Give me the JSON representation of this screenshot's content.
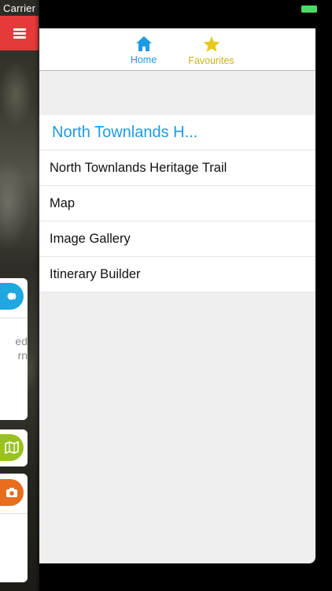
{
  "status_bar": {
    "carrier": "Carrier"
  },
  "background_app": {
    "menu_icon": "hamburger-icon",
    "peek_text_lines": [
      "ed",
      "rn"
    ]
  },
  "tabs": [
    {
      "label": "Home",
      "icon": "home-icon",
      "color": "#1d9be3"
    },
    {
      "label": "Favourites",
      "icon": "star-icon",
      "color": "#c7b21b"
    }
  ],
  "menu": {
    "header": "North Townlands H...",
    "items": [
      {
        "label": "North Townlands Heritage Trail"
      },
      {
        "label": "Map"
      },
      {
        "label": "Image Gallery"
      },
      {
        "label": "Itinerary Builder"
      }
    ]
  },
  "colors": {
    "accent_blue": "#1d9be3",
    "favourites_gold": "#c7b21b",
    "menu_red": "#e63a3a"
  }
}
